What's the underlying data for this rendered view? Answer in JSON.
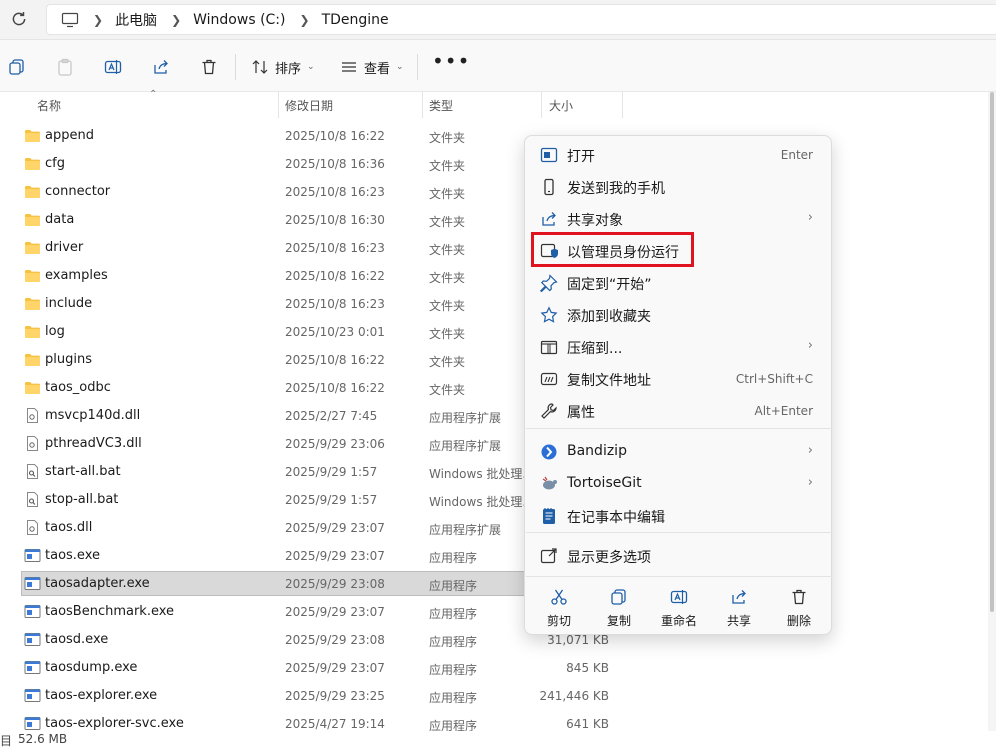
{
  "address": {
    "crumbs": [
      "此电脑",
      "Windows (C:)",
      "TDengine"
    ]
  },
  "toolbar": {
    "sort_label": "排序",
    "view_label": "查看"
  },
  "columns": {
    "name": "名称",
    "date": "修改日期",
    "type": "类型",
    "size": "大小"
  },
  "files": [
    {
      "name": "append",
      "date": "2025/10/8 16:22",
      "type": "文件夹",
      "size": "",
      "icon": "folder-icon"
    },
    {
      "name": "cfg",
      "date": "2025/10/8 16:36",
      "type": "文件夹",
      "size": "",
      "icon": "folder-icon"
    },
    {
      "name": "connector",
      "date": "2025/10/8 16:23",
      "type": "文件夹",
      "size": "",
      "icon": "folder-icon"
    },
    {
      "name": "data",
      "date": "2025/10/8 16:30",
      "type": "文件夹",
      "size": "",
      "icon": "folder-icon"
    },
    {
      "name": "driver",
      "date": "2025/10/8 16:23",
      "type": "文件夹",
      "size": "",
      "icon": "folder-icon"
    },
    {
      "name": "examples",
      "date": "2025/10/8 16:22",
      "type": "文件夹",
      "size": "",
      "icon": "folder-icon"
    },
    {
      "name": "include",
      "date": "2025/10/8 16:23",
      "type": "文件夹",
      "size": "",
      "icon": "folder-icon"
    },
    {
      "name": "log",
      "date": "2025/10/23 0:01",
      "type": "文件夹",
      "size": "",
      "icon": "folder-icon"
    },
    {
      "name": "plugins",
      "date": "2025/10/8 16:22",
      "type": "文件夹",
      "size": "",
      "icon": "folder-icon"
    },
    {
      "name": "taos_odbc",
      "date": "2025/10/8 16:22",
      "type": "文件夹",
      "size": "",
      "icon": "folder-icon"
    },
    {
      "name": "msvcp140d.dll",
      "date": "2025/2/27 7:45",
      "type": "应用程序扩展",
      "size": "",
      "icon": "dll-icon"
    },
    {
      "name": "pthreadVC3.dll",
      "date": "2025/9/29 23:06",
      "type": "应用程序扩展",
      "size": "",
      "icon": "dll-icon"
    },
    {
      "name": "start-all.bat",
      "date": "2025/9/29 1:57",
      "type": "Windows 批处理...",
      "size": "",
      "icon": "bat-icon"
    },
    {
      "name": "stop-all.bat",
      "date": "2025/9/29 1:57",
      "type": "Windows 批处理...",
      "size": "",
      "icon": "bat-icon"
    },
    {
      "name": "taos.dll",
      "date": "2025/9/29 23:07",
      "type": "应用程序扩展",
      "size": "",
      "icon": "dll-icon"
    },
    {
      "name": "taos.exe",
      "date": "2025/9/29 23:07",
      "type": "应用程序",
      "size": "",
      "icon": "exe-icon"
    },
    {
      "name": "taosadapter.exe",
      "date": "2025/9/29 23:08",
      "type": "应用程序",
      "size": "",
      "icon": "exe-icon",
      "selected": true
    },
    {
      "name": "taosBenchmark.exe",
      "date": "2025/9/29 23:07",
      "type": "应用程序",
      "size": "",
      "icon": "exe-icon"
    },
    {
      "name": "taosd.exe",
      "date": "2025/9/29 23:08",
      "type": "应用程序",
      "size": "31,071 KB",
      "icon": "exe-icon"
    },
    {
      "name": "taosdump.exe",
      "date": "2025/9/29 23:07",
      "type": "应用程序",
      "size": "845 KB",
      "icon": "exe-icon"
    },
    {
      "name": "taos-explorer.exe",
      "date": "2025/9/29 23:25",
      "type": "应用程序",
      "size": "241,446 KB",
      "icon": "exe-icon"
    },
    {
      "name": "taos-explorer-svc.exe",
      "date": "2025/4/27 19:14",
      "type": "应用程序",
      "size": "641 KB",
      "icon": "exe-icon"
    }
  ],
  "status": {
    "lead": "目",
    "size_text": "52.6 MB"
  },
  "context_menu": {
    "items": [
      {
        "label": "打开",
        "shortcut": "Enter",
        "icon": "open-icon",
        "arrow": ""
      },
      {
        "label": "发送到我的手机",
        "shortcut": "",
        "icon": "phone-icon",
        "arrow": ""
      },
      {
        "label": "共享对象",
        "shortcut": "",
        "icon": "share-icon",
        "arrow": "›"
      },
      {
        "label": "以管理员身份运行",
        "shortcut": "",
        "icon": "shield-icon",
        "arrow": ""
      },
      {
        "label": "固定到“开始”",
        "shortcut": "",
        "icon": "pin-icon",
        "arrow": ""
      },
      {
        "label": "添加到收藏夹",
        "shortcut": "",
        "icon": "star-icon",
        "arrow": ""
      },
      {
        "label": "压缩到...",
        "shortcut": "",
        "icon": "zip-icon",
        "arrow": "›"
      },
      {
        "label": "复制文件地址",
        "shortcut": "Ctrl+Shift+C",
        "icon": "path-icon",
        "arrow": ""
      },
      {
        "label": "属性",
        "shortcut": "Alt+Enter",
        "icon": "wrench-icon",
        "arrow": ""
      },
      {
        "label": "Bandizip",
        "shortcut": "",
        "icon": "bandizip-icon",
        "arrow": "›"
      },
      {
        "label": "TortoiseGit",
        "shortcut": "",
        "icon": "tortoisegit-icon",
        "arrow": "›"
      },
      {
        "label": "在记事本中编辑",
        "shortcut": "",
        "icon": "notepad-icon",
        "arrow": ""
      },
      {
        "label": "显示更多选项",
        "shortcut": "",
        "icon": "more-options-icon",
        "arrow": ""
      }
    ],
    "quick_actions": [
      {
        "label": "剪切",
        "icon": "scissors-icon"
      },
      {
        "label": "复制",
        "icon": "copy-icon"
      },
      {
        "label": "重命名",
        "icon": "rename-icon"
      },
      {
        "label": "共享",
        "icon": "share-icon"
      },
      {
        "label": "删除",
        "icon": "trash-icon"
      }
    ],
    "highlight_color": "#e0141e"
  },
  "colors": {
    "accent": "#1f5fa8",
    "folder": "#f5c242",
    "selection": "#d9d9d9"
  }
}
